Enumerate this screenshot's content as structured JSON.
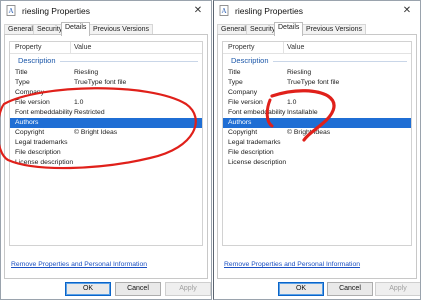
{
  "left_window": {
    "title": "riesling Properties",
    "close_glyph": "✕",
    "tabs": [
      "General",
      "Security",
      "Details",
      "Previous Versions"
    ],
    "active_tab": "Details",
    "columns": {
      "property": "Property",
      "value": "Value"
    },
    "group": "Description",
    "rows": [
      {
        "key": "Title",
        "value": "Riesling"
      },
      {
        "key": "Type",
        "value": "TrueType font file"
      },
      {
        "key": "Company",
        "value": ""
      },
      {
        "key": "File version",
        "value": "1.0"
      },
      {
        "key": "Font embeddability",
        "value": "Restricted"
      },
      {
        "key": "Authors",
        "value": ""
      },
      {
        "key": "Copyright",
        "value": "© Bright Ideas"
      },
      {
        "key": "Legal trademarks",
        "value": ""
      },
      {
        "key": "File description",
        "value": ""
      },
      {
        "key": "License description",
        "value": ""
      }
    ],
    "selected_row": "Authors",
    "remove_link": "Remove Properties and Personal Information",
    "buttons": {
      "ok": "OK",
      "cancel": "Cancel",
      "apply": "Apply"
    }
  },
  "right_window": {
    "title": "riesling Properties",
    "close_glyph": "✕",
    "tabs": [
      "General",
      "Security",
      "Details",
      "Previous Versions"
    ],
    "active_tab": "Details",
    "columns": {
      "property": "Property",
      "value": "Value"
    },
    "group": "Description",
    "rows": [
      {
        "key": "Title",
        "value": "Riesling"
      },
      {
        "key": "Type",
        "value": "TrueType font file"
      },
      {
        "key": "Company",
        "value": ""
      },
      {
        "key": "File version",
        "value": "1.0"
      },
      {
        "key": "Font embeddability",
        "value": "Installable"
      },
      {
        "key": "Authors",
        "value": ""
      },
      {
        "key": "Copyright",
        "value": "© Bright Ideas"
      },
      {
        "key": "Legal trademarks",
        "value": ""
      },
      {
        "key": "File description",
        "value": ""
      },
      {
        "key": "License description",
        "value": ""
      }
    ],
    "selected_row": "Authors",
    "remove_link": "Remove Properties and Personal Information",
    "buttons": {
      "ok": "OK",
      "cancel": "Cancel",
      "apply": "Apply"
    }
  },
  "colors": {
    "selection": "#1f6ed4",
    "group_header": "#1a56a8",
    "link": "#1a4fc2",
    "annotation_stroke": "#e0201a"
  },
  "icons": [
    "font-file-icon",
    "close-icon"
  ]
}
